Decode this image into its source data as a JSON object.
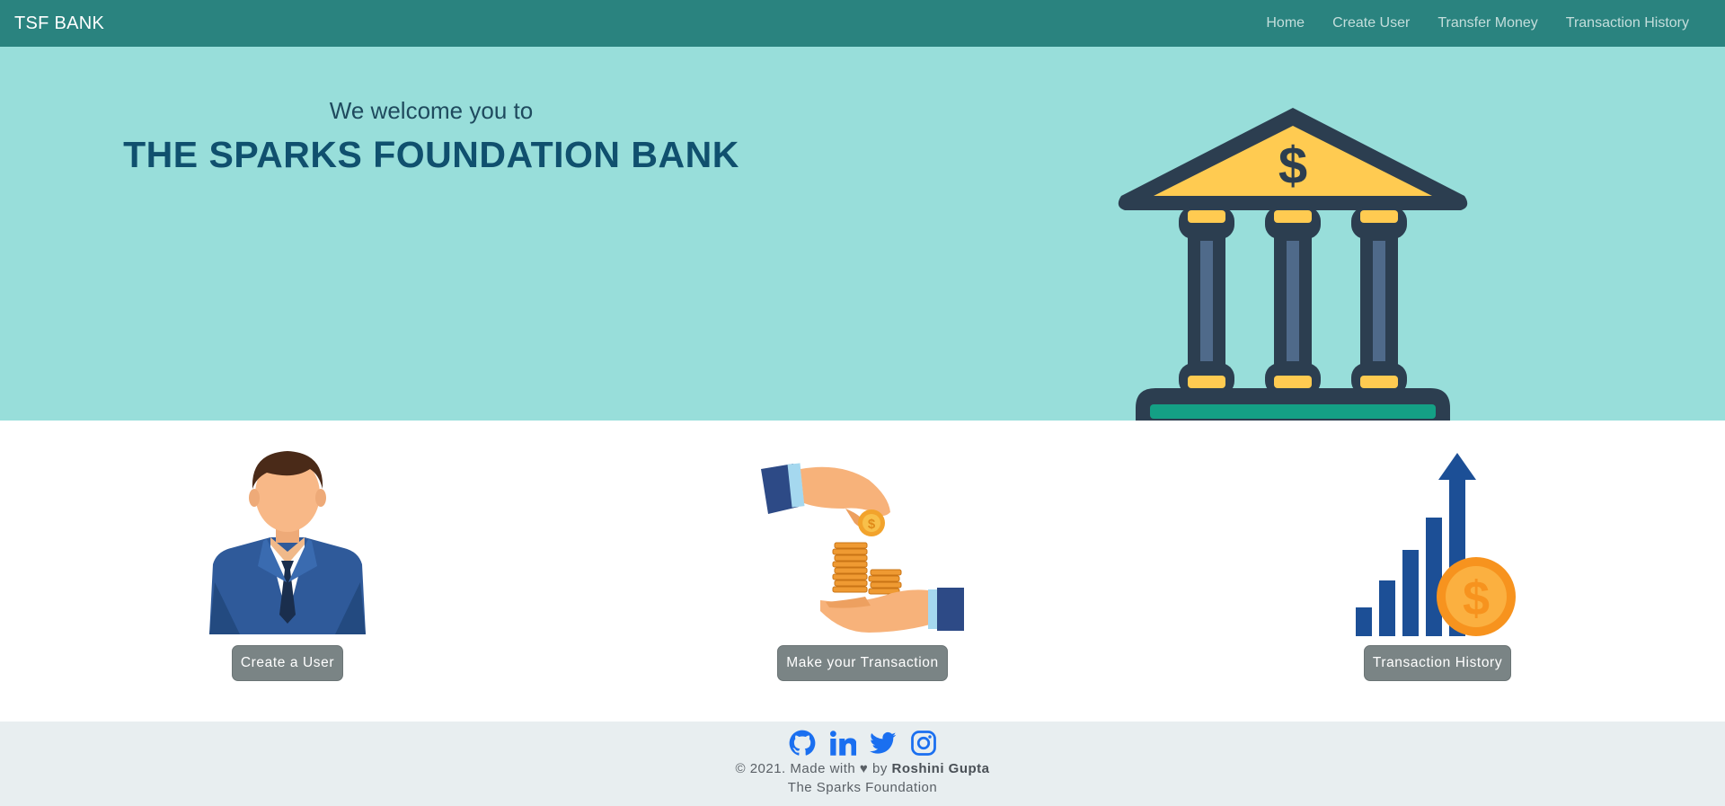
{
  "navbar": {
    "brand": "TSF BANK",
    "links": [
      "Home",
      "Create User",
      "Transfer Money",
      "Transaction History"
    ]
  },
  "hero": {
    "subtitle": "We welcome you to",
    "title": "THE SPARKS FOUNDATION BANK",
    "illustration": "bank-building-icon",
    "currency_symbol": "$"
  },
  "cards": [
    {
      "icon": "businessman-icon",
      "button": "Create a User"
    },
    {
      "icon": "money-transfer-icon",
      "button": "Make your Transaction"
    },
    {
      "icon": "growth-chart-icon",
      "button": "Transaction History",
      "currency_symbol": "$"
    }
  ],
  "footer": {
    "social_icons": [
      "github-icon",
      "linkedin-icon",
      "twitter-icon",
      "instagram-icon"
    ],
    "copyright_prefix": "© 2021. Made with ♥ by",
    "author": "Roshini Gupta",
    "organization": "The Sparks Foundation"
  },
  "colors": {
    "navbar": "#2a837f",
    "hero": "#98deda",
    "title": "#10506e",
    "button": "#7a8485",
    "footer": "#e8eef0",
    "social": "#1a6ff0"
  }
}
